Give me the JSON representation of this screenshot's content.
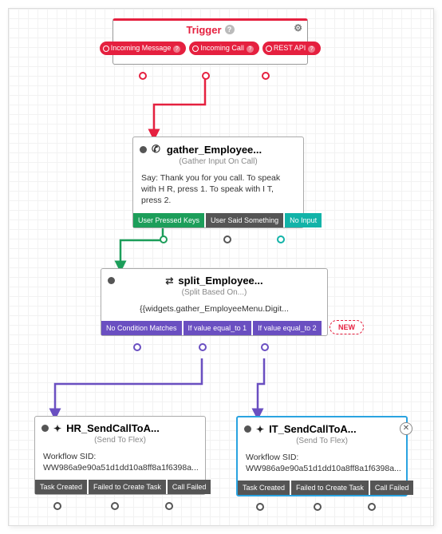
{
  "trigger": {
    "title": "Trigger",
    "outputs": [
      "Incoming Message",
      "Incoming Call",
      "REST API"
    ]
  },
  "gather": {
    "title": "gather_Employee...",
    "subtype": "(Gather Input On Call)",
    "body": "Say: Thank you for you call. To speak with H R, press 1. To speak with I T, press 2.",
    "outputs": [
      "User Pressed Keys",
      "User Said Something",
      "No Input"
    ]
  },
  "split": {
    "title": "split_Employee...",
    "subtype": "(Split Based On...)",
    "body": "{{widgets.gather_EmployeeMenu.Digit...",
    "outputs": [
      "No Condition Matches",
      "If value equal_to 1",
      "If value equal_to 2"
    ],
    "new_label": "NEW"
  },
  "hr": {
    "title": "HR_SendCallToA...",
    "subtype": "(Send To Flex)",
    "body_label": "Workflow SID:",
    "body_value": "WW986a9e90a51d1dd10a8ff8a1f6398a...",
    "outputs": [
      "Task Created",
      "Failed to Create Task",
      "Call Failed"
    ]
  },
  "it": {
    "title": "IT_SendCallToA...",
    "subtype": "(Send To Flex)",
    "body_label": "Workflow SID:",
    "body_value": "WW986a9e90a51d1dd10a8ff8a1f6398a...",
    "outputs": [
      "Task Created",
      "Failed to Create Task",
      "Call Failed"
    ]
  }
}
